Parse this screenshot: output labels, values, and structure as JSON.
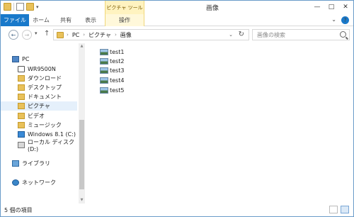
{
  "titlebar": {
    "title": "画像",
    "contextual_tab": "ピクチャ ツール",
    "quick_access_dropdown": "▾",
    "minimize": "—",
    "maximize": "□",
    "close": "✕"
  },
  "ribbon": {
    "tabs": [
      "ファイル",
      "ホーム",
      "共有",
      "表示",
      "操作"
    ],
    "expand_chevron": "⌄",
    "help": "?"
  },
  "nav": {
    "back": "←",
    "forward": "→",
    "recent_dropdown": "▾",
    "up": "↑",
    "breadcrumb": [
      "PC",
      "ピクチャ",
      "画像"
    ],
    "crumb_separator": "›",
    "address_dropdown": "⌄",
    "refresh": "↻",
    "search_placeholder": "画像の検索"
  },
  "sidebar": {
    "items": [
      {
        "label": "PC",
        "icon": "pc-icon"
      },
      {
        "label": "WR9500N",
        "icon": "router-icon"
      },
      {
        "label": "ダウンロード",
        "icon": "downloads-icon"
      },
      {
        "label": "デスクトップ",
        "icon": "desktop-folder-icon"
      },
      {
        "label": "ドキュメント",
        "icon": "documents-folder-icon"
      },
      {
        "label": "ピクチャ",
        "icon": "pictures-folder-icon"
      },
      {
        "label": "ビデオ",
        "icon": "videos-folder-icon"
      },
      {
        "label": "ミュージック",
        "icon": "music-folder-icon"
      },
      {
        "label": "Windows 8.1 (C:)",
        "icon": "system-drive-icon"
      },
      {
        "label": "ローカル ディスク (D:)",
        "icon": "local-disk-icon"
      },
      {
        "label": "ライブラリ",
        "icon": "library-icon"
      },
      {
        "label": "ネットワーク",
        "icon": "network-icon"
      }
    ],
    "selected": "ピクチャ"
  },
  "files": [
    {
      "name": "test1"
    },
    {
      "name": "test2"
    },
    {
      "name": "test3"
    },
    {
      "name": "test4"
    },
    {
      "name": "test5"
    }
  ],
  "status": {
    "item_count": "5 個の項目"
  }
}
